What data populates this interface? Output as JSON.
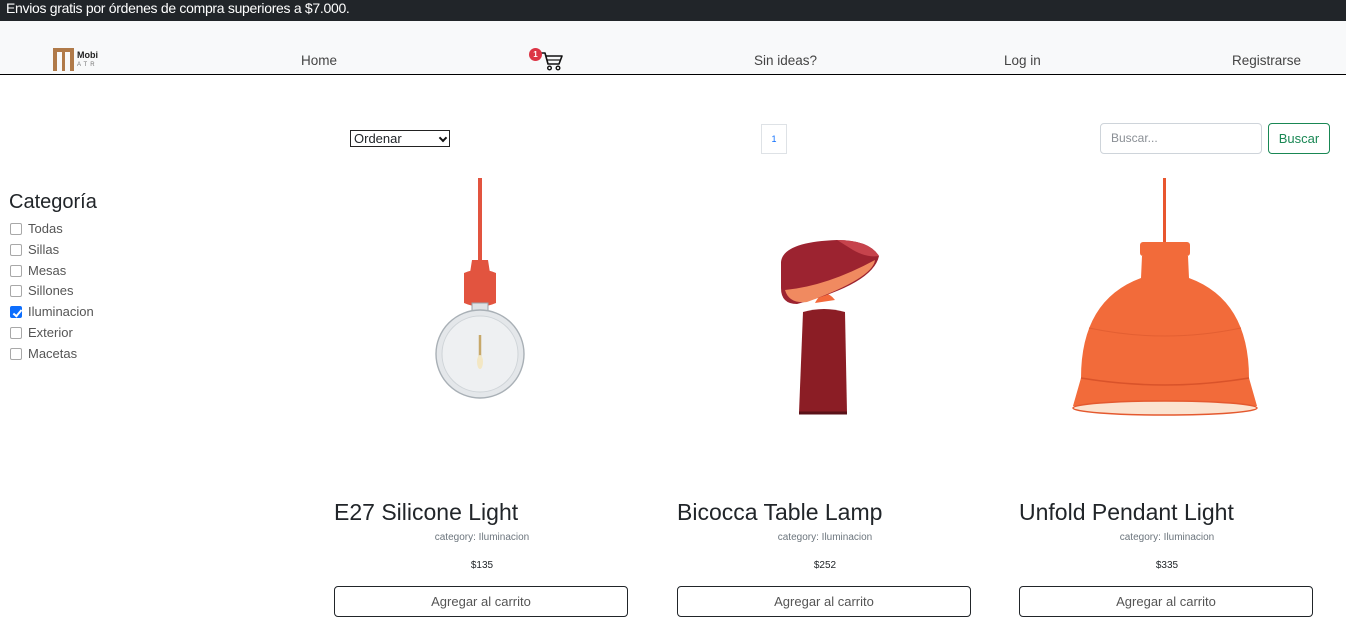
{
  "promo": {
    "text": "Envios gratis por órdenes de compra superiores a $7.000."
  },
  "navbar": {
    "logo": {
      "word": "Mobi",
      "sub": "ATR"
    },
    "links": {
      "home": "Home",
      "ideas": "Sin ideas?",
      "login": "Log in",
      "register": "Registrarse"
    },
    "cart": {
      "count": "1",
      "icon": "cart-icon"
    }
  },
  "sidebar": {
    "title": "Categoría",
    "items": [
      {
        "label": "Todas",
        "checked": false
      },
      {
        "label": "Sillas",
        "checked": false
      },
      {
        "label": "Mesas",
        "checked": false
      },
      {
        "label": "Sillones",
        "checked": false
      },
      {
        "label": "Iluminacion",
        "checked": true
      },
      {
        "label": "Exterior",
        "checked": false
      },
      {
        "label": "Macetas",
        "checked": false
      }
    ]
  },
  "toolbar": {
    "sort": {
      "selected": "Ordenar"
    },
    "pagination": {
      "current": "1"
    },
    "search": {
      "placeholder": "Buscar...",
      "button": "Buscar"
    }
  },
  "products": [
    {
      "name": "E27 Silicone Light",
      "category": "category: Iluminacion",
      "price": "$135",
      "button": "Agregar al carrito",
      "accent": "#e2543f"
    },
    {
      "name": "Bicocca Table Lamp",
      "category": "category: Iluminacion",
      "price": "$252",
      "button": "Agregar al carrito",
      "accent": "#8b1d25"
    },
    {
      "name": "Unfold Pendant Light",
      "category": "category: Iluminacion",
      "price": "$335",
      "button": "Agregar al carrito",
      "accent": "#f26b3a"
    }
  ],
  "colors": {
    "primary": "#0d6efd",
    "success": "#198754",
    "danger": "#dc3545",
    "dark": "#212529"
  }
}
